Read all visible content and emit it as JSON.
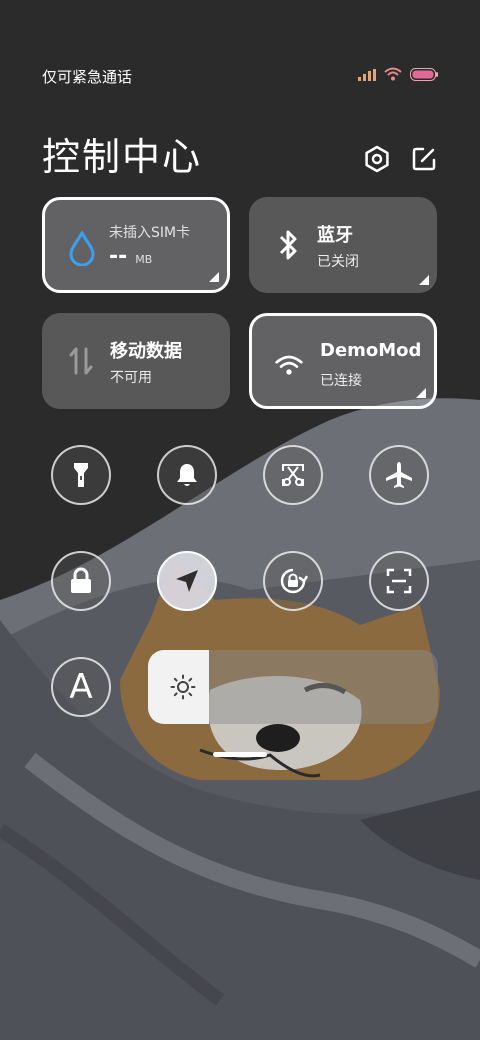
{
  "status_bar": {
    "carrier_text": "仅可紧急通话",
    "icons": [
      "signal-icon",
      "wifi-icon",
      "battery-icon"
    ]
  },
  "header": {
    "title": "控制中心",
    "icons": [
      "settings-icon",
      "edit-icon"
    ]
  },
  "tiles": {
    "data_usage": {
      "title": "未插入SIM卡",
      "value": "--",
      "unit": "MB",
      "icon": "water-drop-icon"
    },
    "bluetooth": {
      "title": "蓝牙",
      "status": "已关闭",
      "icon": "bluetooth-icon"
    },
    "mobile_data": {
      "title": "移动数据",
      "status": "不可用",
      "icon": "data-arrows-icon"
    },
    "wifi": {
      "title": "DemoMod",
      "status": "已连接",
      "icon": "wifi-icon"
    }
  },
  "toggles": [
    {
      "name": "flashlight",
      "icon": "flashlight-icon",
      "on": false
    },
    {
      "name": "silent",
      "icon": "bell-icon",
      "on": false
    },
    {
      "name": "screenshot",
      "icon": "scissors-icon",
      "on": false
    },
    {
      "name": "airplane",
      "icon": "airplane-icon",
      "on": false
    },
    {
      "name": "lock-screen",
      "icon": "lock-icon",
      "on": false
    },
    {
      "name": "location",
      "icon": "location-arrow-icon",
      "on": true
    },
    {
      "name": "auto-rotate",
      "icon": "rotate-lock-icon",
      "on": false
    },
    {
      "name": "scanner",
      "icon": "scan-icon",
      "on": false
    },
    {
      "name": "auto-brightness",
      "icon": "letter-a-icon",
      "on": false
    }
  ],
  "auto_brightness_label": "A",
  "brightness": {
    "level": 0.21,
    "icon": "sun-icon"
  },
  "colors": {
    "accent": "#3aa0f0",
    "battery": "#e07aa0"
  }
}
